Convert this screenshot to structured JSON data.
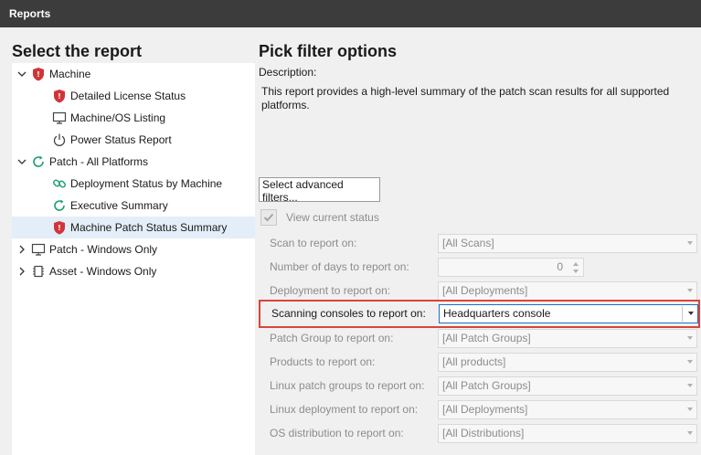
{
  "window": {
    "title": "Reports"
  },
  "left": {
    "heading": "Select the report",
    "tree": [
      {
        "label": "Machine",
        "expanded": true,
        "icon": "shield-red-icon"
      },
      {
        "label": "Detailed License Status",
        "icon": "shield-red-icon"
      },
      {
        "label": "Machine/OS Listing",
        "icon": "monitor-icon"
      },
      {
        "label": "Power Status Report",
        "icon": "power-icon"
      },
      {
        "label": "Patch - All Platforms",
        "expanded": true,
        "icon": "refresh-green-icon"
      },
      {
        "label": "Deployment Status by Machine",
        "icon": "link-green-icon"
      },
      {
        "label": "Executive Summary",
        "icon": "refresh-green-icon"
      },
      {
        "label": "Machine Patch Status Summary",
        "icon": "shield-red-icon",
        "selected": true
      },
      {
        "label": "Patch - Windows Only",
        "expanded": false,
        "icon": "monitor-icon"
      },
      {
        "label": "Asset - Windows Only",
        "expanded": false,
        "icon": "chip-icon"
      }
    ]
  },
  "right": {
    "heading": "Pick filter options",
    "description_label": "Description:",
    "description_text": "This report provides a high-level summary of the patch scan results for all supported platforms.",
    "advanced_button": "Select advanced filters...",
    "view_current_status": "View current status",
    "filters": [
      {
        "label": "Scan to report on:",
        "value": "[All Scans]"
      },
      {
        "label": "Number of days to report on:",
        "value": "0"
      },
      {
        "label": "Deployment to report on:",
        "value": "[All Deployments]"
      },
      {
        "label": "Scanning consoles to report on:",
        "value": "Headquarters console"
      },
      {
        "label": "Patch Group to report on:",
        "value": "[All Patch Groups]"
      },
      {
        "label": "Products to report on:",
        "value": "[All products]"
      },
      {
        "label": "Linux patch groups to report on:",
        "value": "[All Patch Groups]"
      },
      {
        "label": "Linux deployment to report on:",
        "value": "[All Deployments]"
      },
      {
        "label": "OS distribution to report on:",
        "value": "[All Distributions]"
      }
    ]
  },
  "colors": {
    "titlebar": "#3c3c3c",
    "highlight": "#d9453d",
    "selected_row": "#e4eef8",
    "focus": "#1e6fc4"
  }
}
